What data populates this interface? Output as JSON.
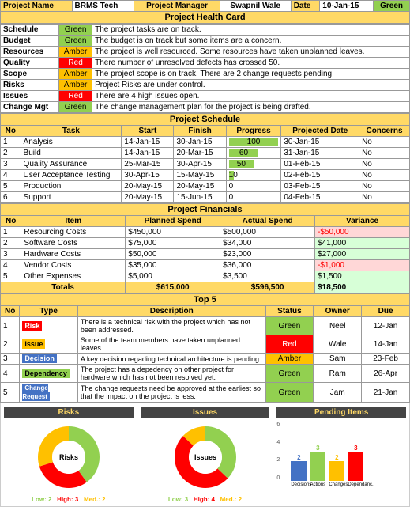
{
  "header": {
    "project_name_label": "Project Name",
    "project_name_value": "BRMS Tech",
    "project_manager_label": "Project Manager",
    "project_manager_value": "Swapnil Wale",
    "date_label": "Date",
    "date_value": "10-Jan-15",
    "status_value": "Green"
  },
  "health_card": {
    "title": "Project Health Card",
    "rows": [
      {
        "name": "Schedule",
        "status": "Green",
        "status_class": "green-bg",
        "comment": "The project tasks are on track."
      },
      {
        "name": "Budget",
        "status": "Green",
        "status_class": "green-bg",
        "comment": "The budget is on track but some items are a concern."
      },
      {
        "name": "Resources",
        "status": "Amber",
        "status_class": "amber-bg",
        "comment": "The project is well resourced. Some resources have taken unplanned leaves."
      },
      {
        "name": "Quality",
        "status": "Red",
        "status_class": "red-bg",
        "comment": "There number of unresolved defects has crossed 50."
      },
      {
        "name": "Scope",
        "status": "Amber",
        "status_class": "amber-bg",
        "comment": "The project scope is on track. There are 2 change requests pending."
      },
      {
        "name": "Risks",
        "status": "Amber",
        "status_class": "amber-bg",
        "comment": "Project Risks are under control."
      },
      {
        "name": "Issues",
        "status": "Red",
        "status_class": "red-bg",
        "comment": "There are 4 high issues open."
      },
      {
        "name": "Change Mgt",
        "status": "Green",
        "status_class": "green-bg",
        "comment": "The change management plan for the project is being drafted."
      }
    ]
  },
  "schedule": {
    "title": "Project Schedule",
    "headers": [
      "No",
      "Task",
      "Start",
      "Finish",
      "Progress",
      "Projected Date",
      "Concerns"
    ],
    "rows": [
      {
        "no": 1,
        "task": "Analysis",
        "start": "14-Jan-15",
        "finish": "30-Jan-15",
        "progress": 100,
        "projected": "30-Jan-15",
        "concerns": "No"
      },
      {
        "no": 2,
        "task": "Build",
        "start": "14-Jan-15",
        "finish": "20-Mar-15",
        "progress": 60,
        "projected": "31-Jan-15",
        "concerns": "No"
      },
      {
        "no": 3,
        "task": "Quality Assurance",
        "start": "25-Mar-15",
        "finish": "30-Apr-15",
        "progress": 50,
        "projected": "01-Feb-15",
        "concerns": "No"
      },
      {
        "no": 4,
        "task": "User Acceptance Testing",
        "start": "30-Apr-15",
        "finish": "15-May-15",
        "progress": 10,
        "projected": "02-Feb-15",
        "concerns": "No"
      },
      {
        "no": 5,
        "task": "Production",
        "start": "20-May-15",
        "finish": "20-May-15",
        "progress": 0,
        "projected": "03-Feb-15",
        "concerns": "No"
      },
      {
        "no": 6,
        "task": "Support",
        "start": "20-May-15",
        "finish": "15-Jun-15",
        "progress": 0,
        "projected": "04-Feb-15",
        "concerns": "No"
      }
    ]
  },
  "financials": {
    "title": "Project Financials",
    "headers": [
      "No",
      "Item",
      "Planned Spend",
      "Actual Spend",
      "Variance"
    ],
    "rows": [
      {
        "no": 1,
        "item": "Resourcing Costs",
        "planned": "$450,000",
        "actual": "$500,000",
        "variance": "-$50,000",
        "neg": true
      },
      {
        "no": 2,
        "item": "Software Costs",
        "planned": "$75,000",
        "actual": "$34,000",
        "variance": "$41,000",
        "neg": false
      },
      {
        "no": 3,
        "item": "Hardware Costs",
        "planned": "$50,000",
        "actual": "$23,000",
        "variance": "$27,000",
        "neg": false
      },
      {
        "no": 4,
        "item": "Vendor Costs",
        "planned": "$35,000",
        "actual": "$36,000",
        "variance": "-$1,000",
        "neg": true
      },
      {
        "no": 5,
        "item": "Other Expenses",
        "planned": "$5,000",
        "actual": "$3,500",
        "variance": "$1,500",
        "neg": false
      }
    ],
    "totals": {
      "label": "Totals",
      "planned": "$615,000",
      "actual": "$596,500",
      "variance": "$18,500",
      "neg": false
    }
  },
  "top5": {
    "title": "Top 5",
    "headers": [
      "No",
      "Type",
      "Description",
      "Status",
      "Owner",
      "Due"
    ],
    "rows": [
      {
        "no": 1,
        "type": "Risk",
        "type_class": "risk-type-risk",
        "description": "There is a technical risk with the project which has not been addressed.",
        "status": "Green",
        "status_class": "top5-status-green",
        "owner": "Neel",
        "due": "12-Jan"
      },
      {
        "no": 2,
        "type": "Issue",
        "type_class": "risk-type-issue",
        "description": "Some of the team members have taken unplanned leaves.",
        "status": "Red",
        "status_class": "top5-status-red",
        "owner": "Wale",
        "due": "14-Jan"
      },
      {
        "no": 3,
        "type": "Decision",
        "type_class": "risk-type-decision",
        "description": "A key decision regading technical architecture is pending.",
        "status": "Amber",
        "status_class": "top5-status-amber",
        "owner": "Sam",
        "due": "23-Feb"
      },
      {
        "no": 4,
        "type": "Dependency",
        "type_class": "risk-type-dependency",
        "description": "The project has a depedency on other project for hardware which has not been resolved yet.",
        "status": "Green",
        "status_class": "top5-status-green",
        "owner": "Ram",
        "due": "26-Apr"
      },
      {
        "no": 5,
        "type": "Change Request",
        "type_class": "risk-type-change",
        "description": "The change requests need be approved at the earliest so that the impact on the project is less.",
        "status": "Green",
        "status_class": "top5-status-green",
        "owner": "Jam",
        "due": "21-Jan"
      }
    ]
  },
  "charts": {
    "risks_title": "Risks",
    "issues_title": "Issues",
    "pending_title": "Pending Items",
    "risks_segments": [
      {
        "label": "Low: 2",
        "color": "#92D050",
        "pct": 40
      },
      {
        "label": "High: 3",
        "color": "#FF0000",
        "pct": 30
      },
      {
        "label": "Med.: 2",
        "color": "#FFC000",
        "pct": 30
      }
    ],
    "issues_segments": [
      {
        "label": "Low: 3",
        "color": "#92D050",
        "pct": 37
      },
      {
        "label": "High: 4",
        "color": "#FF0000",
        "pct": 50
      },
      {
        "label": "Med.: 2",
        "color": "#FFC000",
        "pct": 13
      }
    ],
    "pending_bars": [
      {
        "label": "Decisions",
        "value": 2,
        "color": "#4472C4"
      },
      {
        "label": "Actions",
        "value": 3,
        "color": "#92D050"
      },
      {
        "label": "Changes",
        "value": 2,
        "color": "#FFC000"
      },
      {
        "label": "Dependanc.",
        "value": 3,
        "color": "#FF0000"
      }
    ]
  }
}
